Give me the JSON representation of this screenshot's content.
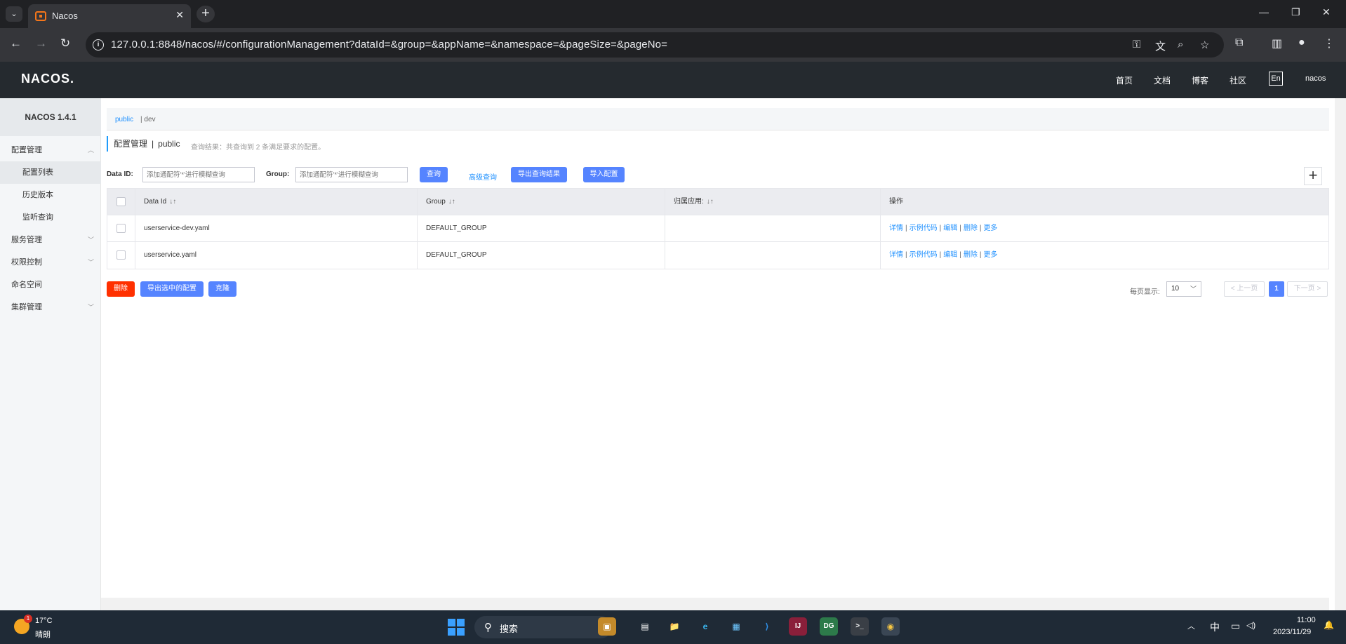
{
  "browser": {
    "tab_title": "Nacos",
    "url": "127.0.0.1:8848/nacos/#/configurationManagement?dataId=&group=&appName=&namespace=&pageSize=&pageNo=",
    "tab_menu_glyph": "⌄",
    "close_glyph": "✕",
    "newtab_glyph": "+",
    "minimize_glyph": "—",
    "restore_glyph": "❐",
    "winclose_glyph": "✕",
    "back_glyph": "←",
    "forward_glyph": "→",
    "reload_glyph": "↻",
    "info_glyph": "i"
  },
  "nacos": {
    "logo": "NACOS.",
    "nav": [
      "首页",
      "文档",
      "博客",
      "社区"
    ],
    "lang": "En",
    "user": "nacos"
  },
  "sidebar": {
    "version": "NACOS 1.4.1",
    "items": [
      {
        "label": "配置管理",
        "expanded": true
      },
      {
        "label": "配置列表"
      },
      {
        "label": "历史版本"
      },
      {
        "label": "监听查询"
      },
      {
        "label": "服务管理"
      },
      {
        "label": "权限控制"
      },
      {
        "label": "命名空间"
      },
      {
        "label": "集群管理"
      }
    ],
    "arrow_up": "︿",
    "arrow_down": "﹀"
  },
  "namespace": {
    "public": "public",
    "sep": "|",
    "dev": "dev"
  },
  "page": {
    "title": "配置管理",
    "pipe": "|",
    "namespace": "public",
    "result_hint": "查询结果：共查询到 2 条满足要求的配置。"
  },
  "filters": {
    "data_id_label": "Data ID:",
    "data_id_placeholder": "添加通配符'*'进行模糊查询",
    "group_label": "Group:",
    "group_placeholder": "添加通配符'*'进行模糊查询",
    "query": "查询",
    "advanced_query": "高级查询",
    "export_results": "导出查询结果",
    "import_config": "导入配置",
    "plus": "+"
  },
  "table": {
    "columns": [
      "Data Id",
      "Group",
      "归属应用:",
      "操作"
    ],
    "sort_glyph": "↓↑",
    "rows": [
      {
        "data_id": "userservice-dev.yaml",
        "group": "DEFAULT_GROUP",
        "app": ""
      },
      {
        "data_id": "userservice.yaml",
        "group": "DEFAULT_GROUP",
        "app": ""
      }
    ],
    "actions": [
      "详情",
      "示例代码",
      "编辑",
      "删除",
      "更多"
    ],
    "action_sep": "|"
  },
  "bottom": {
    "delete": "删除",
    "export_selected": "导出选中的配置",
    "clone": "克隆",
    "page_size_label": "每页显示:",
    "page_size": "10",
    "chev": "﹀",
    "prev": "< 上一页",
    "page": "1",
    "next": "下一页 >"
  },
  "taskbar": {
    "weather_badge": "1",
    "temp": "17°C",
    "weather": "晴朗",
    "search_glyph": "⚲",
    "search": "搜索",
    "apps": [
      "▣",
      "▤",
      "📁",
      "e",
      "▦",
      "⟩",
      "IJ",
      "DG",
      ">_",
      "◉"
    ],
    "ime": "中",
    "time": "11:00",
    "date": "2023/11/29",
    "chevron_up": "︿",
    "net_glyph": "▭",
    "vol_glyph": "◁)",
    "bell_glyph": "🔔"
  },
  "colors": {
    "accent_blue": "#5584ff",
    "link_blue": "#1e90ff",
    "danger_red": "#ff3000",
    "header_dark": "#252a2f",
    "chrome_dark": "#202124"
  }
}
